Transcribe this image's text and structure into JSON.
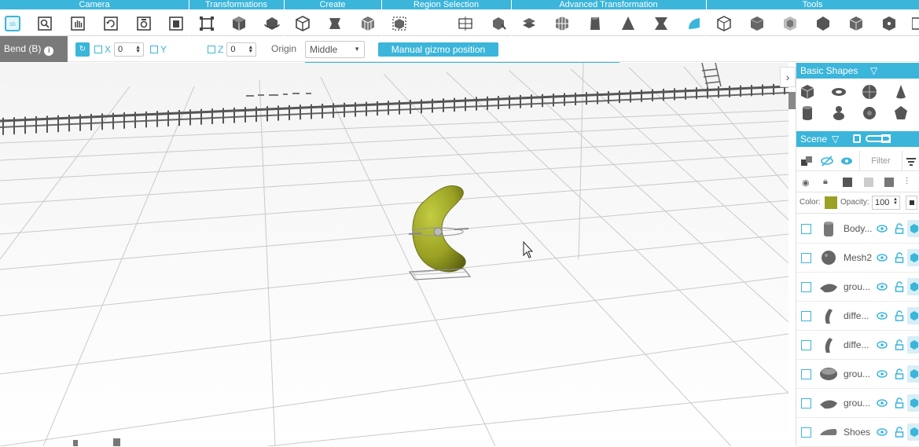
{
  "toolbar": {
    "groups": [
      {
        "label": "Camera"
      },
      {
        "label": "Transformations"
      },
      {
        "label": "Create"
      },
      {
        "label": "Region Selection"
      },
      {
        "label": "Advanced Transformation"
      },
      {
        "label": "Tools"
      }
    ],
    "tools": {
      "camera": [
        "camera-reset-icon",
        "zoom-icon",
        "pan-icon",
        "rotate-view-icon",
        "fit-view-icon",
        "save-view-icon"
      ],
      "transformations": [
        "transform-icon",
        "scale-icon",
        "rotate-icon"
      ],
      "create": [
        "shape-create-icon",
        "extrude-icon",
        "mesh-create-icon"
      ],
      "region_selection": [
        "region-select-icon",
        "box-select-icon",
        "lasso-select-icon"
      ],
      "advanced": [
        "twist-icon",
        "warp-icon",
        "bend-icon",
        "taper-icon",
        "pinch-icon",
        "smooth-icon"
      ],
      "tools": [
        "measure-icon",
        "cut-icon",
        "hollow-icon",
        "shell-icon",
        "repair-icon",
        "export-icon"
      ]
    }
  },
  "options": {
    "tool_name": "Bend (B)",
    "info_glyph": "i",
    "x_label": "X",
    "x_value": "0",
    "y_label": "Y",
    "z_label": "Z",
    "z_value": "0",
    "origin_label": "Origin",
    "origin_value": "Middle",
    "gizmo_button": "Manual gizmo position"
  },
  "viewport": {
    "collapse_glyph": "›",
    "object_color": "#9aa123",
    "grid_color": "#c9c9c9"
  },
  "panel": {
    "basic_shapes_title": "Basic Shapes",
    "basic_shapes": [
      "cube-icon",
      "torus-icon",
      "sphere-icon",
      "cone-icon",
      "cylinder-icon",
      "figure-icon",
      "gear-icon",
      "polyhedron-icon"
    ],
    "scene_title": "Scene",
    "filter_placeholder": "Filter",
    "color_label": "Color:",
    "color_swatch": "#9aa123",
    "opacity_label": "Opacity:",
    "opacity_value": "100",
    "scene_items": [
      {
        "name": "Body...",
        "thumb": "cylinder-thumb"
      },
      {
        "name": "Mesh2",
        "thumb": "head-thumb"
      },
      {
        "name": "grou...",
        "thumb": "group-thumb"
      },
      {
        "name": "diffe...",
        "thumb": "difference-thumb"
      },
      {
        "name": "diffe...",
        "thumb": "difference-thumb"
      },
      {
        "name": "grou...",
        "thumb": "bowl-thumb"
      },
      {
        "name": "grou...",
        "thumb": "group-thumb"
      },
      {
        "name": "Shoes",
        "thumb": "shoe-thumb"
      }
    ]
  }
}
